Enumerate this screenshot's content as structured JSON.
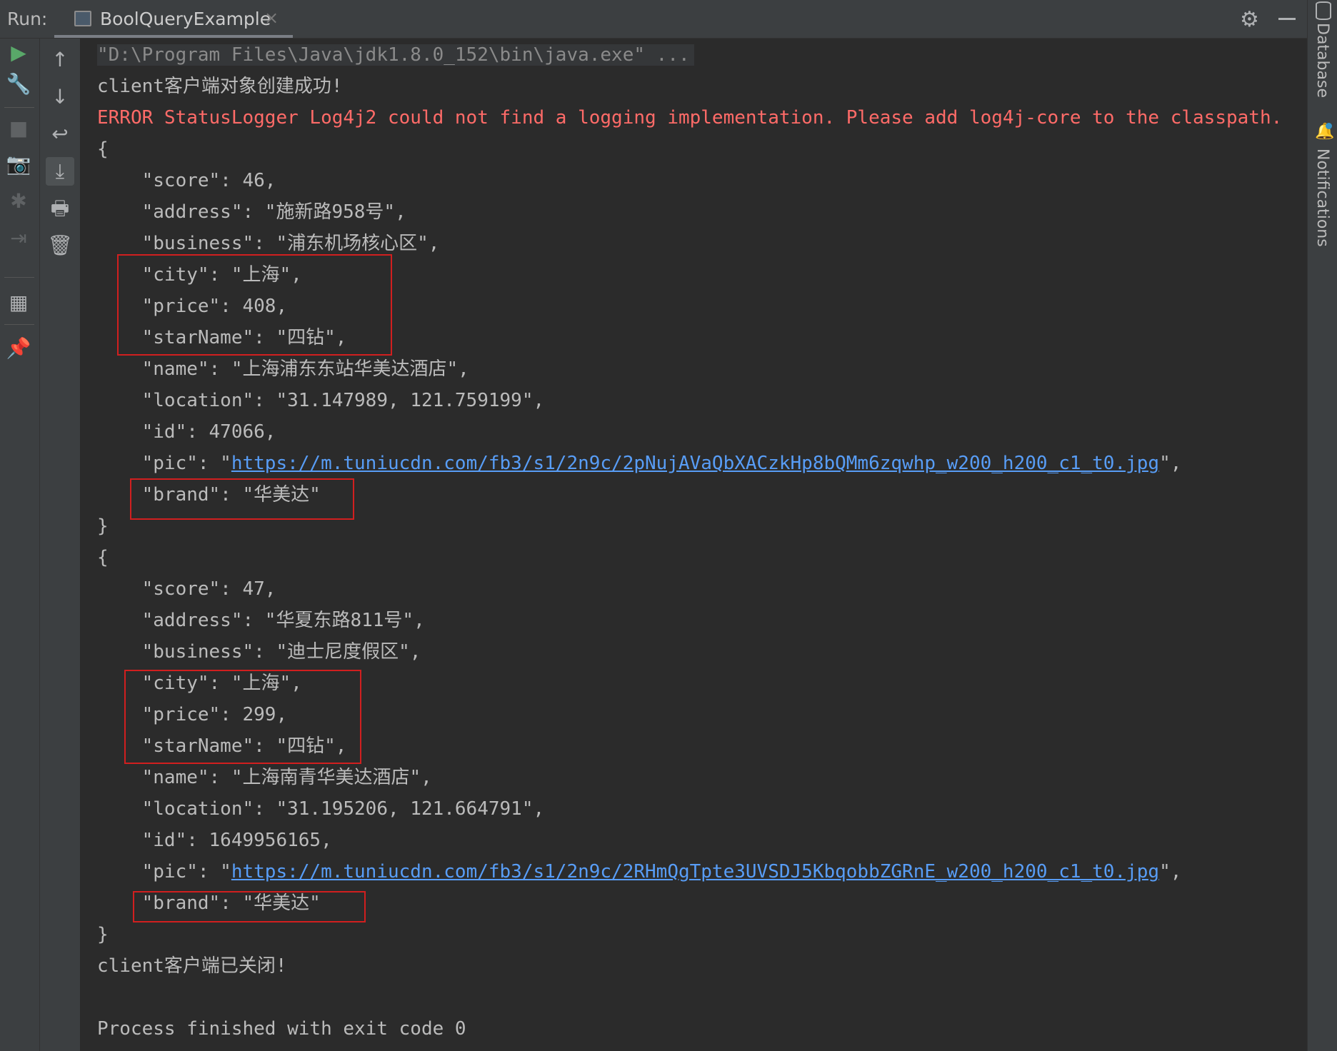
{
  "topbar": {
    "run_label": "Run:",
    "tab_title": "BoolQueryExample",
    "tab_close": "×",
    "gear_icon": "gear-icon",
    "minimize_icon": "minimize-icon"
  },
  "left_toolbar": {
    "outer": [
      "rerun-icon",
      "wrench-icon",
      "stop-icon",
      "camera-icon",
      "debug-icon",
      "login-icon",
      "layout-icon",
      "pin-icon"
    ],
    "inner": [
      "up-arrow-icon",
      "down-arrow-icon",
      "soft-wrap-icon",
      "scroll-to-end-icon",
      "print-icon",
      "trash-icon"
    ]
  },
  "right_strip": {
    "database_label": "Database",
    "notifications_label": "Notifications"
  },
  "console": {
    "command": "\"D:\\Program Files\\Java\\jdk1.8.0_152\\bin\\java.exe\" ...",
    "client_created": "client客户端对象创建成功!",
    "error": "ERROR StatusLogger Log4j2 could not find a logging implementation. Please add log4j-core to the classpath.",
    "records": [
      {
        "open": "{",
        "score": "    \"score\": 46,",
        "address": "    \"address\": \"施新路958号\",",
        "business": "    \"business\": \"浦东机场核心区\",",
        "city": "    \"city\": \"上海\",",
        "price": "    \"price\": 408,",
        "starName": "    \"starName\": \"四钻\",",
        "name": "    \"name\": \"上海浦东东站华美达酒店\",",
        "location": "    \"location\": \"31.147989, 121.759199\",",
        "id": "    \"id\": 47066,",
        "pic_prefix": "    \"pic\": \"",
        "pic_url": "https://m.tuniucdn.com/fb3/s1/2n9c/2pNujAVaQbXACzkHp8bQMm6zqwhp_w200_h200_c1_t0.jpg",
        "pic_suffix": "\",",
        "brand": "    \"brand\": \"华美达\"",
        "close": "}"
      },
      {
        "open": "{",
        "score": "    \"score\": 47,",
        "address": "    \"address\": \"华夏东路811号\",",
        "business": "    \"business\": \"迪士尼度假区\",",
        "city": "    \"city\": \"上海\",",
        "price": "    \"price\": 299,",
        "starName": "    \"starName\": \"四钻\",",
        "name": "    \"name\": \"上海南青华美达酒店\",",
        "location": "    \"location\": \"31.195206, 121.664791\",",
        "id": "    \"id\": 1649956165,",
        "pic_prefix": "    \"pic\": \"",
        "pic_url": "https://m.tuniucdn.com/fb3/s1/2n9c/2RHmQgTpte3UVSDJ5KbqobbZGRnE_w200_h200_c1_t0.jpg",
        "pic_suffix": "\",",
        "brand": "    \"brand\": \"华美达\"",
        "close": "}"
      }
    ],
    "client_closed": "client客户端已关闭!",
    "process_finished": "Process finished with exit code 0"
  }
}
